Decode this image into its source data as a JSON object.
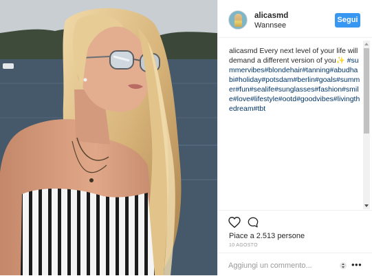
{
  "post": {
    "username": "alicasmd",
    "location": "Wannsee",
    "follow_label": "Segui",
    "caption_user": "alicasmd",
    "caption_text": "Every next level of your life will demand a different version of you✨",
    "caption_tags": "#summervibes#blondehair#tanning#abudhabi#holiday#potsdam#berlin#goals#summer#fun#sealife#sunglasses#fashion#smile#love#lifestyle#ootd#goodvibes#livingthedream#tbt",
    "likes": "Piace a 2.513 persone",
    "date": "10 AGOSTO",
    "comment_placeholder": "Aggiungi un commento...",
    "more_label": "•••"
  },
  "icons": {
    "like": "heart-icon",
    "comment": "comment-icon",
    "more": "more-dots-icon",
    "stepper": "stepper-icon"
  },
  "colors": {
    "accent": "#3897f0",
    "tag_link": "#003569",
    "text": "#262626",
    "muted": "#999999"
  }
}
